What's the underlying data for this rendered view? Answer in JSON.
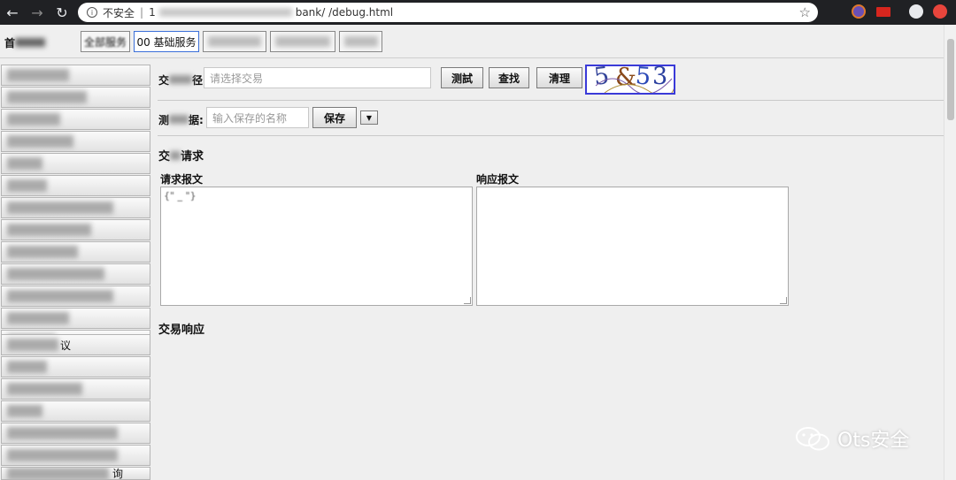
{
  "browser": {
    "security_label": "不安全",
    "url_visible": "bank/     /debug.html",
    "url_prefix": "1",
    "star": "☆"
  },
  "top": {
    "home_label": "首",
    "tabs": [
      {
        "label": "全部服务"
      },
      {
        "label": "00 基础服务"
      }
    ]
  },
  "sidebar": {
    "items": [
      {
        "label": ""
      },
      {
        "label": ""
      },
      {
        "label": ""
      },
      {
        "label": ""
      },
      {
        "label": ""
      },
      {
        "label": ""
      },
      {
        "label": ""
      },
      {
        "label": ""
      },
      {
        "label": ""
      },
      {
        "label": ""
      },
      {
        "label": ""
      },
      {
        "label": ""
      },
      {
        "label": ""
      },
      {
        "label": "议"
      },
      {
        "label": ""
      },
      {
        "label": ""
      },
      {
        "label": ""
      },
      {
        "label": ""
      },
      {
        "label": ""
      },
      {
        "label": "询"
      }
    ]
  },
  "main": {
    "trade_label_start": "交",
    "trade_label_end": "径:",
    "trade_placeholder": "请选择交易",
    "test_button": "测試",
    "find_button": "查找",
    "clear_button": "清理",
    "captcha": [
      "5",
      "&",
      "5",
      "3"
    ],
    "data_label_start": "测",
    "data_label_end": "据:",
    "save_name_placeholder": "输入保存的名称",
    "save_button": "保存",
    "dropdown_arrow": "▼",
    "request_section_start": "交",
    "request_section_end": "请求",
    "request_msg_label_start": "请求",
    "request_msg_label_end": "报文",
    "request_msg_value": "{\"      _         \"}",
    "response_msg_label": "响应报文",
    "response_section": "交易响应"
  },
  "watermark": {
    "text": "Ots安全"
  },
  "colors": {
    "browser_bar": "#202124",
    "page_bg": "#efefef",
    "active_tab_border": "#3b6fd8",
    "captcha_border": "#3a3ad8"
  }
}
